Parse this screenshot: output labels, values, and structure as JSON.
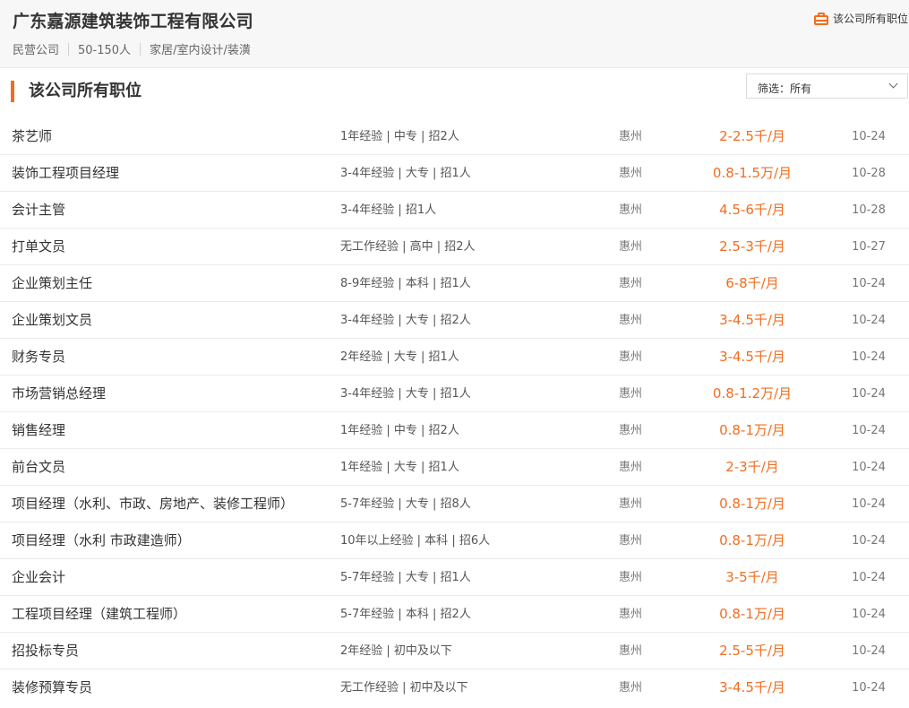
{
  "company": {
    "name": "广东嘉源建筑装饰工程有限公司",
    "type": "民营公司",
    "size": "50-150人",
    "industry": "家居/室内设计/装潢",
    "all_jobs_link": "该公司所有职位",
    "icon": "briefcase-icon",
    "accent_color": "#f26d1f"
  },
  "section": {
    "title": "该公司所有职位"
  },
  "filter": {
    "label": "筛选：所有"
  },
  "jobs": [
    {
      "title": "茶艺师",
      "requirements": "1年经验 | 中专 | 招2人",
      "city": "惠州",
      "salary": "2-2.5千/月",
      "date": "10-24"
    },
    {
      "title": "装饰工程项目经理",
      "requirements": "3-4年经验 | 大专 | 招1人",
      "city": "惠州",
      "salary": "0.8-1.5万/月",
      "date": "10-28"
    },
    {
      "title": "会计主管",
      "requirements": "3-4年经验 | 招1人",
      "city": "惠州",
      "salary": "4.5-6千/月",
      "date": "10-28"
    },
    {
      "title": "打单文员",
      "requirements": "无工作经验 | 高中 | 招2人",
      "city": "惠州",
      "salary": "2.5-3千/月",
      "date": "10-27"
    },
    {
      "title": "企业策划主任",
      "requirements": "8-9年经验 | 本科 | 招1人",
      "city": "惠州",
      "salary": "6-8千/月",
      "date": "10-24"
    },
    {
      "title": "企业策划文员",
      "requirements": "3-4年经验 | 大专 | 招2人",
      "city": "惠州",
      "salary": "3-4.5千/月",
      "date": "10-24"
    },
    {
      "title": "财务专员",
      "requirements": "2年经验 | 大专 | 招1人",
      "city": "惠州",
      "salary": "3-4.5千/月",
      "date": "10-24"
    },
    {
      "title": "市场营销总经理",
      "requirements": "3-4年经验 | 大专 | 招1人",
      "city": "惠州",
      "salary": "0.8-1.2万/月",
      "date": "10-24"
    },
    {
      "title": "销售经理",
      "requirements": "1年经验 | 中专 | 招2人",
      "city": "惠州",
      "salary": "0.8-1万/月",
      "date": "10-24"
    },
    {
      "title": "前台文员",
      "requirements": "1年经验 | 大专 | 招1人",
      "city": "惠州",
      "salary": "2-3千/月",
      "date": "10-24"
    },
    {
      "title": "项目经理（水利、市政、房地产、装修工程师）",
      "requirements": "5-7年经验 | 大专 | 招8人",
      "city": "惠州",
      "salary": "0.8-1万/月",
      "date": "10-24"
    },
    {
      "title": "项目经理（水利 市政建造师）",
      "requirements": "10年以上经验 | 本科 | 招6人",
      "city": "惠州",
      "salary": "0.8-1万/月",
      "date": "10-24"
    },
    {
      "title": "企业会计",
      "requirements": "5-7年经验 | 大专 | 招1人",
      "city": "惠州",
      "salary": "3-5千/月",
      "date": "10-24"
    },
    {
      "title": "工程项目经理（建筑工程师）",
      "requirements": "5-7年经验 | 本科 | 招2人",
      "city": "惠州",
      "salary": "0.8-1万/月",
      "date": "10-24"
    },
    {
      "title": "招投标专员",
      "requirements": "2年经验 | 初中及以下",
      "city": "惠州",
      "salary": "2.5-5千/月",
      "date": "10-24"
    },
    {
      "title": "装修预算专员",
      "requirements": "无工作经验 | 初中及以下",
      "city": "惠州",
      "salary": "3-4.5千/月",
      "date": "10-24"
    }
  ]
}
